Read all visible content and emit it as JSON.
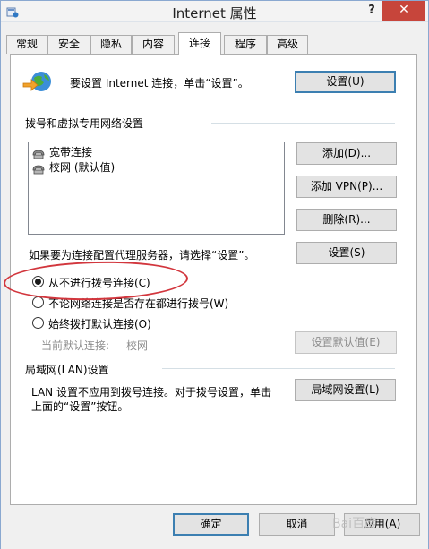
{
  "window": {
    "title": "Internet 属性",
    "help_label": "?",
    "close_label": "✕"
  },
  "tabs": [
    {
      "label": "常规"
    },
    {
      "label": "安全"
    },
    {
      "label": "隐私"
    },
    {
      "label": "内容"
    },
    {
      "label": "连接",
      "active": true
    },
    {
      "label": "程序"
    },
    {
      "label": "高级"
    }
  ],
  "setup": {
    "description": "要设置 Internet 连接，单击“设置”。",
    "button_label": "设置(U)"
  },
  "dialup": {
    "group_title": "拨号和虚拟专用网络设置",
    "connections": [
      {
        "label": "宽带连接"
      },
      {
        "label": "校网 (默认值)"
      }
    ],
    "add_label": "添加(D)...",
    "add_vpn_label": "添加 VPN(P)...",
    "remove_label": "删除(R)...",
    "proxy_hint": "如果要为连接配置代理服务器，请选择“设置”。",
    "settings_label": "设置(S)",
    "options": [
      {
        "label": "从不进行拨号连接(C)",
        "selected": true
      },
      {
        "label": "不论网络连接是否存在都进行拨号(W)",
        "selected": false
      },
      {
        "label": "始终拨打默认连接(O)",
        "selected": false
      }
    ],
    "current_default_label": "当前默认连接:",
    "current_default_value": "校网",
    "set_default_label": "设置默认值(E)"
  },
  "lan": {
    "group_title": "局域网(LAN)设置",
    "description_line1": "LAN 设置不应用到拨号连接。对于拨号设置，单击",
    "description_line2": "上面的“设置”按钮。",
    "button_label": "局域网设置(L)"
  },
  "footer": {
    "ok_label": "确定",
    "cancel_label": "取消",
    "apply_label": "应用(A)",
    "watermark": "Bai百度"
  },
  "colors": {
    "highlight_ellipse": "#d2363d",
    "close_button": "#c7453b",
    "default_button_border": "#3c7fb1"
  }
}
